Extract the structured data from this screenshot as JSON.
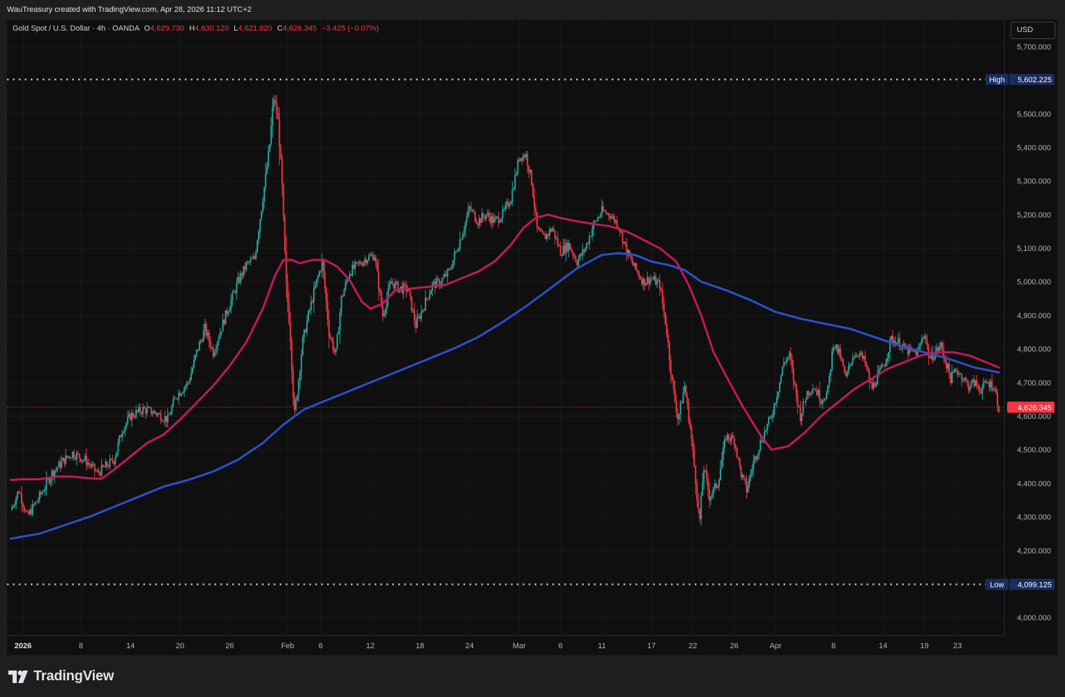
{
  "header": {
    "credit": "WauTreasury created with TradingView.com, Apr 28, 2026 11:12 UTC+2"
  },
  "legend": {
    "symbol": "Gold Spot / U.S. Dollar · 4h · OANDA",
    "open_label": "O",
    "open_value": "4,629.730",
    "high_label": "H",
    "high_value": "4,630.120",
    "low_label": "L",
    "low_value": "4,621.820",
    "close_label": "C",
    "close_value": "4,626.345",
    "change": "−3.425 (−0.07%)"
  },
  "currency_button": {
    "label": "USD"
  },
  "footer": {
    "logo_text": "TradingView",
    "logo_icon": "tradingview-logo-icon"
  },
  "colors": {
    "background": "#0f0f0f",
    "up_candle": "#26a69a",
    "down_candle": "#f23645",
    "ma_fast": "#c2185b",
    "ma_slow": "#2a4fd0",
    "last_price": "#f23645",
    "high_low_label": "#1a2b5e"
  },
  "chart_data": {
    "type": "candlestick",
    "title": "Gold Spot / U.S. Dollar · 4h · OANDA",
    "ylim": [
      3930,
      5760
    ],
    "y_ticks": [
      {
        "value": 5700,
        "label": "5,700.000"
      },
      {
        "value": 5500,
        "label": "5,500.000"
      },
      {
        "value": 5400,
        "label": "5,400.000"
      },
      {
        "value": 5300,
        "label": "5,300.000"
      },
      {
        "value": 5200,
        "label": "5,200.000"
      },
      {
        "value": 5100,
        "label": "5,100.000"
      },
      {
        "value": 5000,
        "label": "5,000.000"
      },
      {
        "value": 4900,
        "label": "4,900.000"
      },
      {
        "value": 4800,
        "label": "4,800.000"
      },
      {
        "value": 4700,
        "label": "4,700.000"
      },
      {
        "value": 4600,
        "label": "4,600.000"
      },
      {
        "value": 4500,
        "label": "4,500.000"
      },
      {
        "value": 4400,
        "label": "4,400.000"
      },
      {
        "value": 4300,
        "label": "4,300.000"
      },
      {
        "value": 4200,
        "label": "4,200.000"
      },
      {
        "value": 4000,
        "label": "4,000.000"
      }
    ],
    "x_ticks": [
      {
        "day": 0,
        "label": "2026",
        "bold": true
      },
      {
        "day": 7,
        "label": "8"
      },
      {
        "day": 13,
        "label": "14"
      },
      {
        "day": 19,
        "label": "20"
      },
      {
        "day": 25,
        "label": "26"
      },
      {
        "day": 32,
        "label": "Feb"
      },
      {
        "day": 36,
        "label": "6"
      },
      {
        "day": 42,
        "label": "12"
      },
      {
        "day": 48,
        "label": "18"
      },
      {
        "day": 54,
        "label": "24"
      },
      {
        "day": 60,
        "label": "Mar"
      },
      {
        "day": 65,
        "label": "6"
      },
      {
        "day": 70,
        "label": "11"
      },
      {
        "day": 76,
        "label": "17"
      },
      {
        "day": 81,
        "label": "22"
      },
      {
        "day": 86,
        "label": "26"
      },
      {
        "day": 91,
        "label": "Apr"
      },
      {
        "day": 98,
        "label": "8"
      },
      {
        "day": 104,
        "label": "14"
      },
      {
        "day": 109,
        "label": "19"
      },
      {
        "day": 113,
        "label": "23"
      }
    ],
    "x_unit": "days since 2026-01-01",
    "close_path": [
      {
        "day": -1.5,
        "close": 4320
      },
      {
        "day": -0.5,
        "close": 4380
      },
      {
        "day": 0.5,
        "close": 4300
      },
      {
        "day": 2,
        "close": 4360
      },
      {
        "day": 3.5,
        "close": 4430
      },
      {
        "day": 5,
        "close": 4470
      },
      {
        "day": 6,
        "close": 4490
      },
      {
        "day": 7.5,
        "close": 4470
      },
      {
        "day": 9,
        "close": 4430
      },
      {
        "day": 11,
        "close": 4470
      },
      {
        "day": 12,
        "close": 4560
      },
      {
        "day": 13,
        "close": 4600
      },
      {
        "day": 14.5,
        "close": 4620
      },
      {
        "day": 16,
        "close": 4610
      },
      {
        "day": 17.5,
        "close": 4590
      },
      {
        "day": 18.5,
        "close": 4660
      },
      {
        "day": 20,
        "close": 4700
      },
      {
        "day": 21,
        "close": 4790
      },
      {
        "day": 22,
        "close": 4860
      },
      {
        "day": 23,
        "close": 4790
      },
      {
        "day": 24.5,
        "close": 4900
      },
      {
        "day": 26,
        "close": 5000
      },
      {
        "day": 27,
        "close": 5050
      },
      {
        "day": 28,
        "close": 5070
      },
      {
        "day": 29,
        "close": 5250
      },
      {
        "day": 29.8,
        "close": 5400
      },
      {
        "day": 30.3,
        "close": 5550
      },
      {
        "day": 30.8,
        "close": 5490
      },
      {
        "day": 31.3,
        "close": 5300
      },
      {
        "day": 31.8,
        "close": 5000
      },
      {
        "day": 32.3,
        "close": 4850
      },
      {
        "day": 32.8,
        "close": 4600
      },
      {
        "day": 33.3,
        "close": 4700
      },
      {
        "day": 33.8,
        "close": 4820
      },
      {
        "day": 34.5,
        "close": 4900
      },
      {
        "day": 35.5,
        "close": 5000
      },
      {
        "day": 36.2,
        "close": 5060
      },
      {
        "day": 37,
        "close": 4850
      },
      {
        "day": 37.8,
        "close": 4780
      },
      {
        "day": 38.5,
        "close": 4950
      },
      {
        "day": 39.5,
        "close": 5030
      },
      {
        "day": 40.5,
        "close": 5050
      },
      {
        "day": 41.5,
        "close": 5070
      },
      {
        "day": 42.5,
        "close": 5080
      },
      {
        "day": 43.5,
        "close": 4900
      },
      {
        "day": 44.5,
        "close": 5000
      },
      {
        "day": 45.5,
        "close": 4980
      },
      {
        "day": 46.5,
        "close": 4980
      },
      {
        "day": 47.5,
        "close": 4870
      },
      {
        "day": 48.5,
        "close": 4930
      },
      {
        "day": 49.5,
        "close": 4990
      },
      {
        "day": 50.5,
        "close": 5000
      },
      {
        "day": 51.5,
        "close": 5030
      },
      {
        "day": 52.5,
        "close": 5100
      },
      {
        "day": 53.3,
        "close": 5160
      },
      {
        "day": 54,
        "close": 5220
      },
      {
        "day": 55,
        "close": 5180
      },
      {
        "day": 56,
        "close": 5200
      },
      {
        "day": 57,
        "close": 5180
      },
      {
        "day": 58,
        "close": 5200
      },
      {
        "day": 59,
        "close": 5250
      },
      {
        "day": 60,
        "close": 5370
      },
      {
        "day": 60.8,
        "close": 5380
      },
      {
        "day": 61.5,
        "close": 5300
      },
      {
        "day": 62.2,
        "close": 5150
      },
      {
        "day": 63,
        "close": 5130
      },
      {
        "day": 64,
        "close": 5160
      },
      {
        "day": 65,
        "close": 5090
      },
      {
        "day": 66,
        "close": 5110
      },
      {
        "day": 67,
        "close": 5060
      },
      {
        "day": 68,
        "close": 5100
      },
      {
        "day": 69,
        "close": 5170
      },
      {
        "day": 70,
        "close": 5210
      },
      {
        "day": 71,
        "close": 5200
      },
      {
        "day": 72,
        "close": 5170
      },
      {
        "day": 73,
        "close": 5090
      },
      {
        "day": 74,
        "close": 5040
      },
      {
        "day": 75,
        "close": 5000
      },
      {
        "day": 76,
        "close": 5010
      },
      {
        "day": 77,
        "close": 4990
      },
      {
        "day": 77.8,
        "close": 4860
      },
      {
        "day": 78.5,
        "close": 4700
      },
      {
        "day": 79.2,
        "close": 4590
      },
      {
        "day": 80,
        "close": 4690
      },
      {
        "day": 80.7,
        "close": 4560
      },
      {
        "day": 81.3,
        "close": 4420
      },
      {
        "day": 81.8,
        "close": 4280
      },
      {
        "day": 82.3,
        "close": 4450
      },
      {
        "day": 83,
        "close": 4360
      },
      {
        "day": 84,
        "close": 4400
      },
      {
        "day": 85,
        "close": 4540
      },
      {
        "day": 86,
        "close": 4530
      },
      {
        "day": 86.8,
        "close": 4430
      },
      {
        "day": 87.5,
        "close": 4380
      },
      {
        "day": 88.3,
        "close": 4460
      },
      {
        "day": 89,
        "close": 4510
      },
      {
        "day": 89.8,
        "close": 4560
      },
      {
        "day": 90.5,
        "close": 4600
      },
      {
        "day": 91.3,
        "close": 4680
      },
      {
        "day": 92,
        "close": 4760
      },
      {
        "day": 92.7,
        "close": 4780
      },
      {
        "day": 93.3,
        "close": 4690
      },
      {
        "day": 94,
        "close": 4600
      },
      {
        "day": 94.8,
        "close": 4670
      },
      {
        "day": 95.6,
        "close": 4690
      },
      {
        "day": 96.5,
        "close": 4650
      },
      {
        "day": 97.3,
        "close": 4670
      },
      {
        "day": 98,
        "close": 4820
      },
      {
        "day": 98.8,
        "close": 4780
      },
      {
        "day": 99.5,
        "close": 4710
      },
      {
        "day": 100.3,
        "close": 4780
      },
      {
        "day": 101,
        "close": 4790
      },
      {
        "day": 101.8,
        "close": 4760
      },
      {
        "day": 102.6,
        "close": 4680
      },
      {
        "day": 103.4,
        "close": 4720
      },
      {
        "day": 104.2,
        "close": 4760
      },
      {
        "day": 105,
        "close": 4830
      },
      {
        "day": 105.8,
        "close": 4820
      },
      {
        "day": 106.6,
        "close": 4800
      },
      {
        "day": 107.4,
        "close": 4790
      },
      {
        "day": 108.2,
        "close": 4790
      },
      {
        "day": 109,
        "close": 4850
      },
      {
        "day": 109.6,
        "close": 4770
      },
      {
        "day": 110.3,
        "close": 4790
      },
      {
        "day": 111,
        "close": 4810
      },
      {
        "day": 111.6,
        "close": 4760
      },
      {
        "day": 112.2,
        "close": 4710
      },
      {
        "day": 112.8,
        "close": 4740
      },
      {
        "day": 113.5,
        "close": 4720
      },
      {
        "day": 114.3,
        "close": 4690
      },
      {
        "day": 115,
        "close": 4700
      },
      {
        "day": 115.8,
        "close": 4680
      },
      {
        "day": 116.6,
        "close": 4700
      },
      {
        "day": 117.4,
        "close": 4690
      },
      {
        "day": 118,
        "close": 4626
      }
    ],
    "moving_average_fast": [
      {
        "day": -1.5,
        "close": 4410
      },
      {
        "day": 0,
        "close": 4412
      },
      {
        "day": 2,
        "close": 4412
      },
      {
        "day": 4,
        "close": 4420
      },
      {
        "day": 6,
        "close": 4420
      },
      {
        "day": 8,
        "close": 4415
      },
      {
        "day": 9.5,
        "close": 4413
      },
      {
        "day": 11,
        "close": 4440
      },
      {
        "day": 13,
        "close": 4480
      },
      {
        "day": 15,
        "close": 4520
      },
      {
        "day": 17,
        "close": 4545
      },
      {
        "day": 19,
        "close": 4590
      },
      {
        "day": 21,
        "close": 4640
      },
      {
        "day": 23,
        "close": 4690
      },
      {
        "day": 25,
        "close": 4750
      },
      {
        "day": 27,
        "close": 4820
      },
      {
        "day": 29,
        "close": 4920
      },
      {
        "day": 30.5,
        "close": 5020
      },
      {
        "day": 31.5,
        "close": 5065
      },
      {
        "day": 32.5,
        "close": 5065
      },
      {
        "day": 33.5,
        "close": 5055
      },
      {
        "day": 35,
        "close": 5065
      },
      {
        "day": 36.5,
        "close": 5065
      },
      {
        "day": 38,
        "close": 5045
      },
      {
        "day": 39.5,
        "close": 5005
      },
      {
        "day": 41,
        "close": 4940
      },
      {
        "day": 42,
        "close": 4920
      },
      {
        "day": 43.5,
        "close": 4935
      },
      {
        "day": 45,
        "close": 4975
      },
      {
        "day": 47,
        "close": 4980
      },
      {
        "day": 49,
        "close": 4985
      },
      {
        "day": 51,
        "close": 4990
      },
      {
        "day": 53,
        "close": 5010
      },
      {
        "day": 55,
        "close": 5030
      },
      {
        "day": 57,
        "close": 5060
      },
      {
        "day": 59,
        "close": 5110
      },
      {
        "day": 60.5,
        "close": 5160
      },
      {
        "day": 62,
        "close": 5190
      },
      {
        "day": 63.5,
        "close": 5200
      },
      {
        "day": 65,
        "close": 5190
      },
      {
        "day": 67,
        "close": 5180
      },
      {
        "day": 69,
        "close": 5172
      },
      {
        "day": 71,
        "close": 5165
      },
      {
        "day": 73,
        "close": 5150
      },
      {
        "day": 75,
        "close": 5125
      },
      {
        "day": 77,
        "close": 5100
      },
      {
        "day": 79,
        "close": 5060
      },
      {
        "day": 80.5,
        "close": 4990
      },
      {
        "day": 82,
        "close": 4900
      },
      {
        "day": 83.5,
        "close": 4790
      },
      {
        "day": 85,
        "close": 4720
      },
      {
        "day": 87,
        "close": 4630
      },
      {
        "day": 89,
        "close": 4550
      },
      {
        "day": 90.5,
        "close": 4500
      },
      {
        "day": 92.5,
        "close": 4510
      },
      {
        "day": 94.5,
        "close": 4550
      },
      {
        "day": 96.5,
        "close": 4600
      },
      {
        "day": 98.5,
        "close": 4640
      },
      {
        "day": 100.5,
        "close": 4680
      },
      {
        "day": 102.5,
        "close": 4710
      },
      {
        "day": 104.5,
        "close": 4740
      },
      {
        "day": 106.5,
        "close": 4760
      },
      {
        "day": 108.5,
        "close": 4780
      },
      {
        "day": 110.5,
        "close": 4790
      },
      {
        "day": 112.5,
        "close": 4790
      },
      {
        "day": 114.5,
        "close": 4780
      },
      {
        "day": 116.5,
        "close": 4760
      },
      {
        "day": 118,
        "close": 4745
      }
    ],
    "moving_average_slow": [
      {
        "day": -1.5,
        "close": 4235
      },
      {
        "day": 2,
        "close": 4250
      },
      {
        "day": 5,
        "close": 4275
      },
      {
        "day": 8,
        "close": 4300
      },
      {
        "day": 11,
        "close": 4330
      },
      {
        "day": 14,
        "close": 4360
      },
      {
        "day": 17,
        "close": 4390
      },
      {
        "day": 20,
        "close": 4410
      },
      {
        "day": 23,
        "close": 4435
      },
      {
        "day": 26,
        "close": 4470
      },
      {
        "day": 29,
        "close": 4520
      },
      {
        "day": 31.5,
        "close": 4575
      },
      {
        "day": 34,
        "close": 4620
      },
      {
        "day": 37,
        "close": 4650
      },
      {
        "day": 40,
        "close": 4680
      },
      {
        "day": 43,
        "close": 4710
      },
      {
        "day": 46,
        "close": 4740
      },
      {
        "day": 49,
        "close": 4770
      },
      {
        "day": 52,
        "close": 4800
      },
      {
        "day": 55,
        "close": 4835
      },
      {
        "day": 58,
        "close": 4880
      },
      {
        "day": 61,
        "close": 4930
      },
      {
        "day": 64,
        "close": 4985
      },
      {
        "day": 67,
        "close": 5040
      },
      {
        "day": 70,
        "close": 5080
      },
      {
        "day": 72,
        "close": 5085
      },
      {
        "day": 74,
        "close": 5080
      },
      {
        "day": 76,
        "close": 5060
      },
      {
        "day": 78,
        "close": 5050
      },
      {
        "day": 80,
        "close": 5035
      },
      {
        "day": 82,
        "close": 5000
      },
      {
        "day": 85,
        "close": 4975
      },
      {
        "day": 88,
        "close": 4945
      },
      {
        "day": 91,
        "close": 4910
      },
      {
        "day": 94,
        "close": 4890
      },
      {
        "day": 97,
        "close": 4875
      },
      {
        "day": 100,
        "close": 4860
      },
      {
        "day": 103,
        "close": 4835
      },
      {
        "day": 106,
        "close": 4810
      },
      {
        "day": 109,
        "close": 4790
      },
      {
        "day": 112,
        "close": 4770
      },
      {
        "day": 115,
        "close": 4745
      },
      {
        "day": 118,
        "close": 4730
      }
    ],
    "high_marker": {
      "value": 5602.225,
      "label": "High",
      "price": "5,602.225"
    },
    "low_marker": {
      "value": 4099.125,
      "label": "Low",
      "price": "4,099.125"
    },
    "last_price": {
      "value": 4626.345,
      "label": "4,626.345"
    }
  }
}
